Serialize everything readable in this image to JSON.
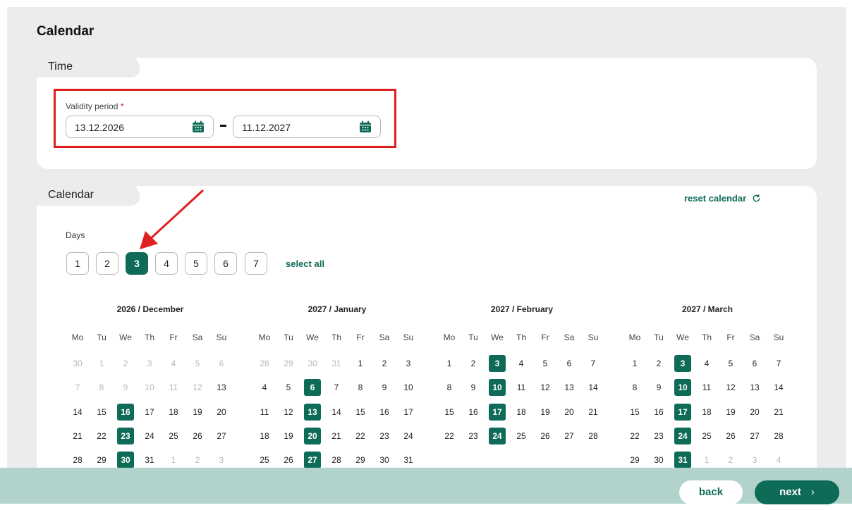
{
  "page": {
    "title": "Calendar"
  },
  "time_section": {
    "tab_label": "Time",
    "validity_label": "Validity period",
    "required_mark": "*",
    "start_date": "13.12.2026",
    "end_date": "11.12.2027",
    "separator": "-"
  },
  "calendar_section": {
    "tab_label": "Calendar",
    "reset_label": "reset calendar",
    "days_label": "Days",
    "day_buttons": [
      "1",
      "2",
      "3",
      "4",
      "5",
      "6",
      "7"
    ],
    "active_day": "3",
    "select_all_label": "select all",
    "weekday_headers": [
      "Mo",
      "Tu",
      "We",
      "Th",
      "Fr",
      "Sa",
      "Su"
    ],
    "months": [
      {
        "title": "2026 / December",
        "rows": [
          [
            [
              "30",
              "m"
            ],
            [
              "1",
              "m"
            ],
            [
              "2",
              "m"
            ],
            [
              "3",
              "m"
            ],
            [
              "4",
              "m"
            ],
            [
              "5",
              "m"
            ],
            [
              "6",
              "m"
            ]
          ],
          [
            [
              "7",
              "m"
            ],
            [
              "8",
              "m"
            ],
            [
              "9",
              "m"
            ],
            [
              "10",
              "m"
            ],
            [
              "11",
              "m"
            ],
            [
              "12",
              "m"
            ],
            [
              "13",
              ""
            ]
          ],
          [
            [
              "14",
              ""
            ],
            [
              "15",
              ""
            ],
            [
              "16",
              "s"
            ],
            [
              "17",
              ""
            ],
            [
              "18",
              ""
            ],
            [
              "19",
              ""
            ],
            [
              "20",
              ""
            ]
          ],
          [
            [
              "21",
              ""
            ],
            [
              "22",
              ""
            ],
            [
              "23",
              "s"
            ],
            [
              "24",
              ""
            ],
            [
              "25",
              ""
            ],
            [
              "26",
              ""
            ],
            [
              "27",
              ""
            ]
          ],
          [
            [
              "28",
              ""
            ],
            [
              "29",
              ""
            ],
            [
              "30",
              "s"
            ],
            [
              "31",
              ""
            ],
            [
              "1",
              "m"
            ],
            [
              "2",
              "m"
            ],
            [
              "3",
              "m"
            ]
          ]
        ]
      },
      {
        "title": "2027 / January",
        "rows": [
          [
            [
              "28",
              "m"
            ],
            [
              "29",
              "m"
            ],
            [
              "30",
              "m"
            ],
            [
              "31",
              "m"
            ],
            [
              "1",
              ""
            ],
            [
              "2",
              ""
            ],
            [
              "3",
              ""
            ]
          ],
          [
            [
              "4",
              ""
            ],
            [
              "5",
              ""
            ],
            [
              "6",
              "s"
            ],
            [
              "7",
              ""
            ],
            [
              "8",
              ""
            ],
            [
              "9",
              ""
            ],
            [
              "10",
              ""
            ]
          ],
          [
            [
              "11",
              ""
            ],
            [
              "12",
              ""
            ],
            [
              "13",
              "s"
            ],
            [
              "14",
              ""
            ],
            [
              "15",
              ""
            ],
            [
              "16",
              ""
            ],
            [
              "17",
              ""
            ]
          ],
          [
            [
              "18",
              ""
            ],
            [
              "19",
              ""
            ],
            [
              "20",
              "s"
            ],
            [
              "21",
              ""
            ],
            [
              "22",
              ""
            ],
            [
              "23",
              ""
            ],
            [
              "24",
              ""
            ]
          ],
          [
            [
              "25",
              ""
            ],
            [
              "26",
              ""
            ],
            [
              "27",
              "s"
            ],
            [
              "28",
              ""
            ],
            [
              "29",
              ""
            ],
            [
              "30",
              ""
            ],
            [
              "31",
              ""
            ]
          ]
        ]
      },
      {
        "title": "2027 / February",
        "rows": [
          [
            [
              "1",
              ""
            ],
            [
              "2",
              ""
            ],
            [
              "3",
              "s"
            ],
            [
              "4",
              ""
            ],
            [
              "5",
              ""
            ],
            [
              "6",
              ""
            ],
            [
              "7",
              ""
            ]
          ],
          [
            [
              "8",
              ""
            ],
            [
              "9",
              ""
            ],
            [
              "10",
              "s"
            ],
            [
              "11",
              ""
            ],
            [
              "12",
              ""
            ],
            [
              "13",
              ""
            ],
            [
              "14",
              ""
            ]
          ],
          [
            [
              "15",
              ""
            ],
            [
              "16",
              ""
            ],
            [
              "17",
              "s"
            ],
            [
              "18",
              ""
            ],
            [
              "19",
              ""
            ],
            [
              "20",
              ""
            ],
            [
              "21",
              ""
            ]
          ],
          [
            [
              "22",
              ""
            ],
            [
              "23",
              ""
            ],
            [
              "24",
              "s"
            ],
            [
              "25",
              ""
            ],
            [
              "26",
              ""
            ],
            [
              "27",
              ""
            ],
            [
              "28",
              ""
            ]
          ]
        ]
      },
      {
        "title": "2027 / March",
        "rows": [
          [
            [
              "1",
              ""
            ],
            [
              "2",
              ""
            ],
            [
              "3",
              "s"
            ],
            [
              "4",
              ""
            ],
            [
              "5",
              ""
            ],
            [
              "6",
              ""
            ],
            [
              "7",
              ""
            ]
          ],
          [
            [
              "8",
              ""
            ],
            [
              "9",
              ""
            ],
            [
              "10",
              "s"
            ],
            [
              "11",
              ""
            ],
            [
              "12",
              ""
            ],
            [
              "13",
              ""
            ],
            [
              "14",
              ""
            ]
          ],
          [
            [
              "15",
              ""
            ],
            [
              "16",
              ""
            ],
            [
              "17",
              "s"
            ],
            [
              "18",
              ""
            ],
            [
              "19",
              ""
            ],
            [
              "20",
              ""
            ],
            [
              "21",
              ""
            ]
          ],
          [
            [
              "22",
              ""
            ],
            [
              "23",
              ""
            ],
            [
              "24",
              "s"
            ],
            [
              "25",
              ""
            ],
            [
              "26",
              ""
            ],
            [
              "27",
              ""
            ],
            [
              "28",
              ""
            ]
          ],
          [
            [
              "29",
              ""
            ],
            [
              "30",
              ""
            ],
            [
              "31",
              "s"
            ],
            [
              "1",
              "m"
            ],
            [
              "2",
              "m"
            ],
            [
              "3",
              "m"
            ],
            [
              "4",
              "m"
            ]
          ]
        ]
      }
    ]
  },
  "footer": {
    "back_label": "back",
    "next_label": "next",
    "next_chevron": "›"
  },
  "colors": {
    "accent": "#0e6b57",
    "highlight": "#e02020",
    "footer": "#b1d3cc"
  },
  "icons": {
    "date_picker": "calendar-icon",
    "reset": "refresh-icon",
    "next": "chevron-right-icon"
  }
}
